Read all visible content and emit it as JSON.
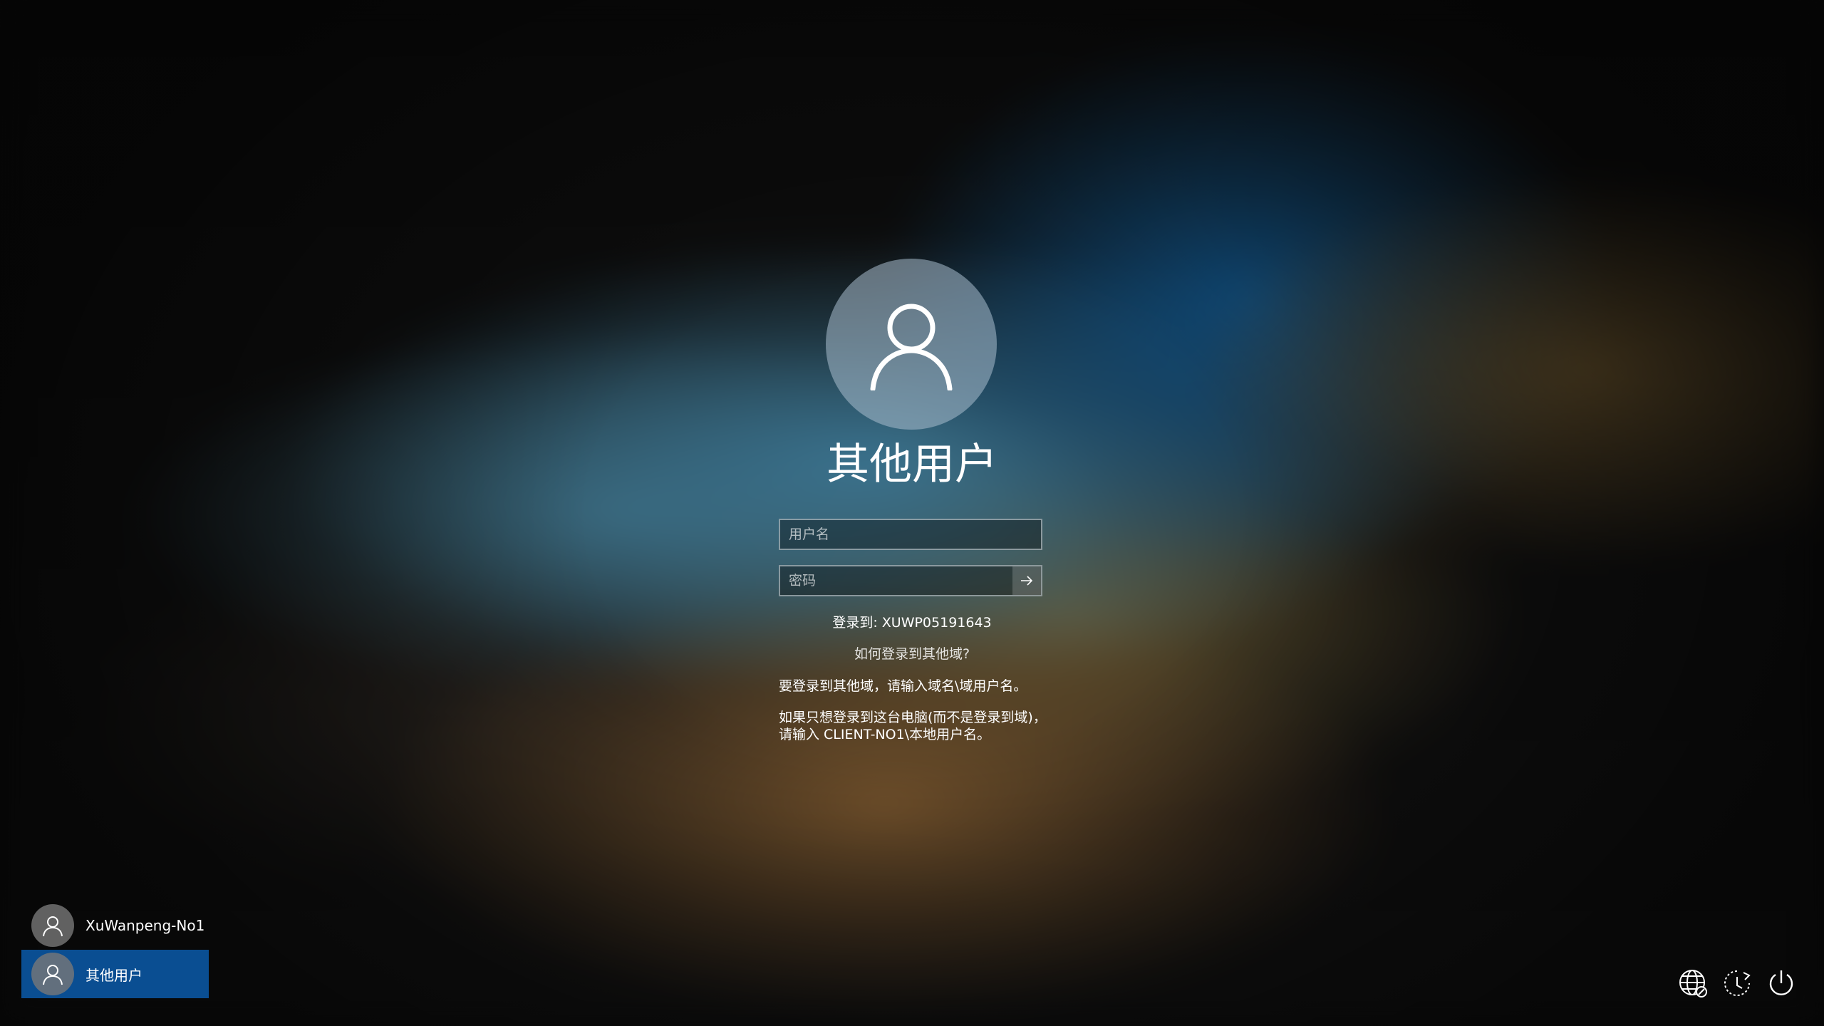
{
  "login": {
    "title": "其他用户",
    "username_placeholder": "用户名",
    "password_placeholder": "密码",
    "sign_in_to": "登录到: XUWP05191643",
    "help_link": "如何登录到其他域?",
    "info_domain": "要登录到其他域，请输入域名\\域用户名。",
    "info_local_line1": "如果只想登录到这台电脑(而不是登录到域)，",
    "info_local_line2": "请输入 CLIENT-NO1\\本地用户名。"
  },
  "user_list": [
    {
      "name": "XuWanpeng-No1",
      "selected": false
    },
    {
      "name": "其他用户",
      "selected": true
    }
  ],
  "system_icons": [
    "network-icon",
    "ease-of-access-icon",
    "power-icon"
  ]
}
